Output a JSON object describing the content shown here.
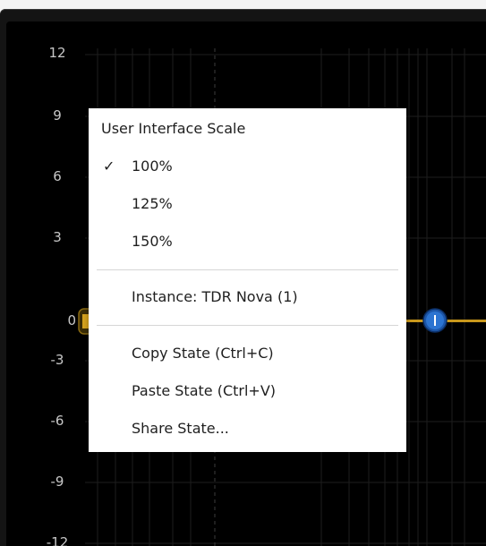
{
  "y_axis": {
    "ticks": [
      "12",
      "9",
      "6",
      "3",
      "0",
      "-3",
      "-6",
      "-9",
      "-12"
    ]
  },
  "curve": {
    "color": "#c9981c",
    "left_node_label": "0",
    "right_node_icon": "band-node-icon",
    "right_node_color": "#1f6fc7"
  },
  "context_menu": {
    "heading": "User Interface Scale",
    "scale_options": [
      {
        "label": "100%",
        "checked": true,
        "check_mark": "✓"
      },
      {
        "label": "125%",
        "checked": false
      },
      {
        "label": "150%",
        "checked": false
      }
    ],
    "instance_label": "Instance: TDR Nova (1)",
    "copy_state": "Copy State (Ctrl+C)",
    "paste_state": "Paste State (Ctrl+V)",
    "share_state": "Share State..."
  }
}
